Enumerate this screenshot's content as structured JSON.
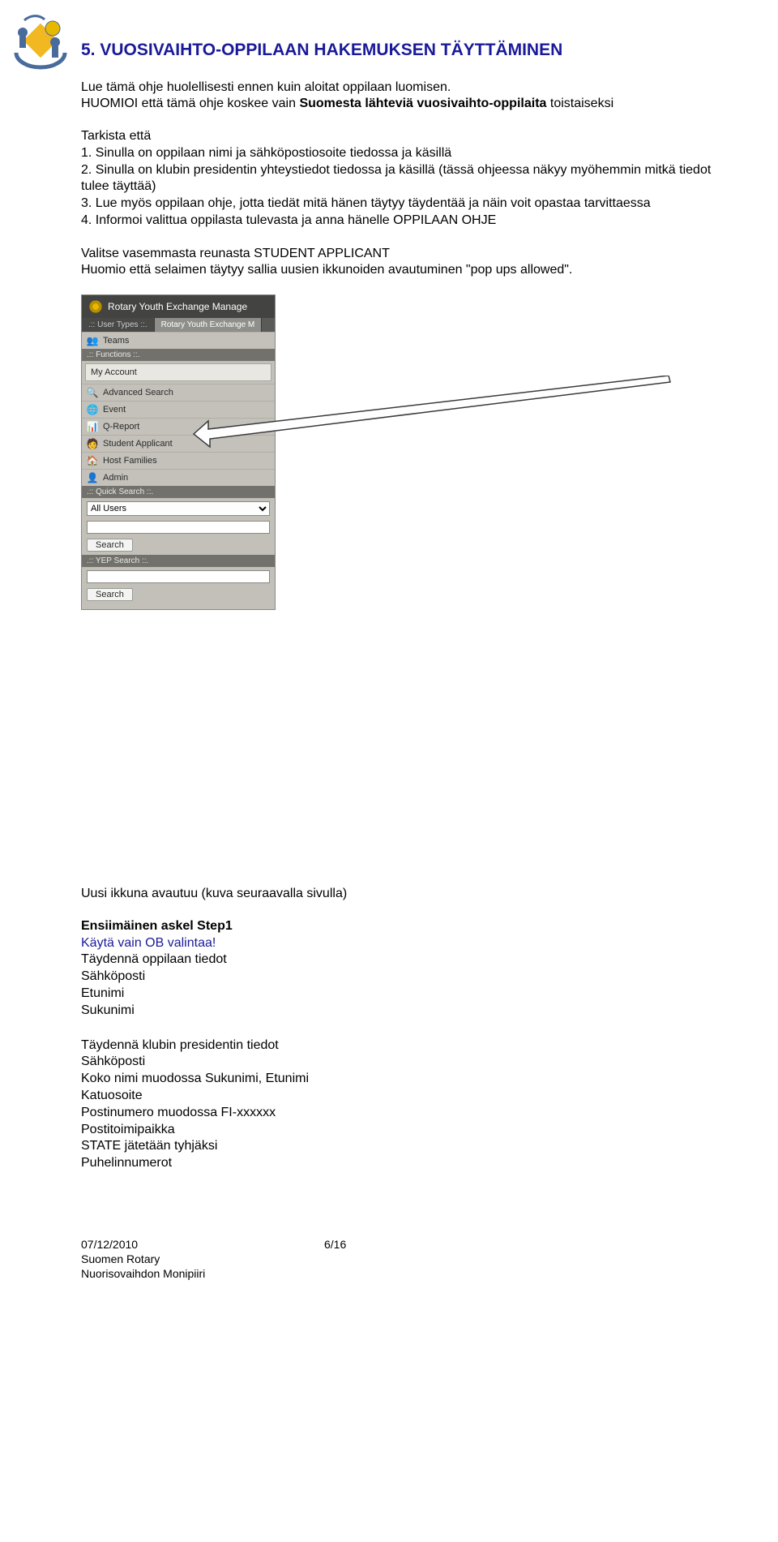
{
  "logo_alt": "Rotary Youth Exchange",
  "heading": "5.  VUOSIVAIHTO-OPPILAAN HAKEMUKSEN TÄYTTÄMINEN",
  "para1_a": "Lue tämä ohje huolellisesti ennen kuin aloitat oppilaan luomisen.",
  "para1_b_pre": "HUOMIOI että tämä ohje koskee vain ",
  "para1_b_bold": "Suomesta lähteviä vuosivaihto-oppilaita",
  "para1_b_post": " toistaiseksi",
  "tarkista": "Tarkista että",
  "l1": "1. Sinulla on oppilaan nimi ja sähköpostiosoite tiedossa ja käsillä",
  "l2": "2. Sinulla on klubin presidentin yhteystiedot tiedossa ja käsillä (tässä ohjeessa näkyy myöhemmin mitkä tiedot tulee täyttää)",
  "l3": "3. Lue myös oppilaan ohje, jotta tiedät mitä hänen täytyy täydentää ja näin voit opastaa tarvittaessa",
  "l4": "4. Informoi valittua oppilasta tulevasta ja anna hänelle OPPILAAN OHJE",
  "para2a": "Valitse vasemmasta reunasta STUDENT APPLICANT",
  "para2b": "Huomio että selaimen täytyy sallia uusien ikkunoiden avautuminen \"pop ups allowed\".",
  "ryem": {
    "title": "Rotary Youth Exchange Manage",
    "tab1": ".:: User Types ::.",
    "tab2": "Rotary Youth Exchange M",
    "teams": "Teams",
    "functions": ".:: Functions ::.",
    "my_account": "My Account",
    "advanced_search": "Advanced Search",
    "event": "Event",
    "qreport": "Q-Report",
    "student_applicant": "Student Applicant",
    "host_families": "Host Families",
    "admin": "Admin",
    "quick": ".:: Quick Search ::.",
    "all_users": "All Users",
    "search": "Search",
    "yep": ".:: YEP Search ::."
  },
  "uusi": "Uusi ikkuna avautuu (kuva seuraavalla sivulla)",
  "step1_bold": "Ensiimäinen askel Step1",
  "step1_blue": "Käytä vain OB valintaa!",
  "tayd1": "Täydennä oppilaan tiedot",
  "sahko": "Sähköposti",
  "etunimi": "Etunimi",
  "sukunimi": "Sukunimi",
  "tayd2": "Täydennä klubin presidentin tiedot",
  "koko": "Koko nimi muodossa Sukunimi, Etunimi",
  "katu": "Katuosoite",
  "posti": "Postinumero muodossa FI-xxxxxx",
  "toimi": "Postitoimipaikka",
  "state": "STATE jätetään tyhjäksi",
  "puh": "Puhelinnumerot",
  "footer_date": "07/12/2010",
  "footer_page": "6/16",
  "footer_l2": "Suomen Rotary",
  "footer_l3": "Nuorisovaihdon Monipiiri"
}
